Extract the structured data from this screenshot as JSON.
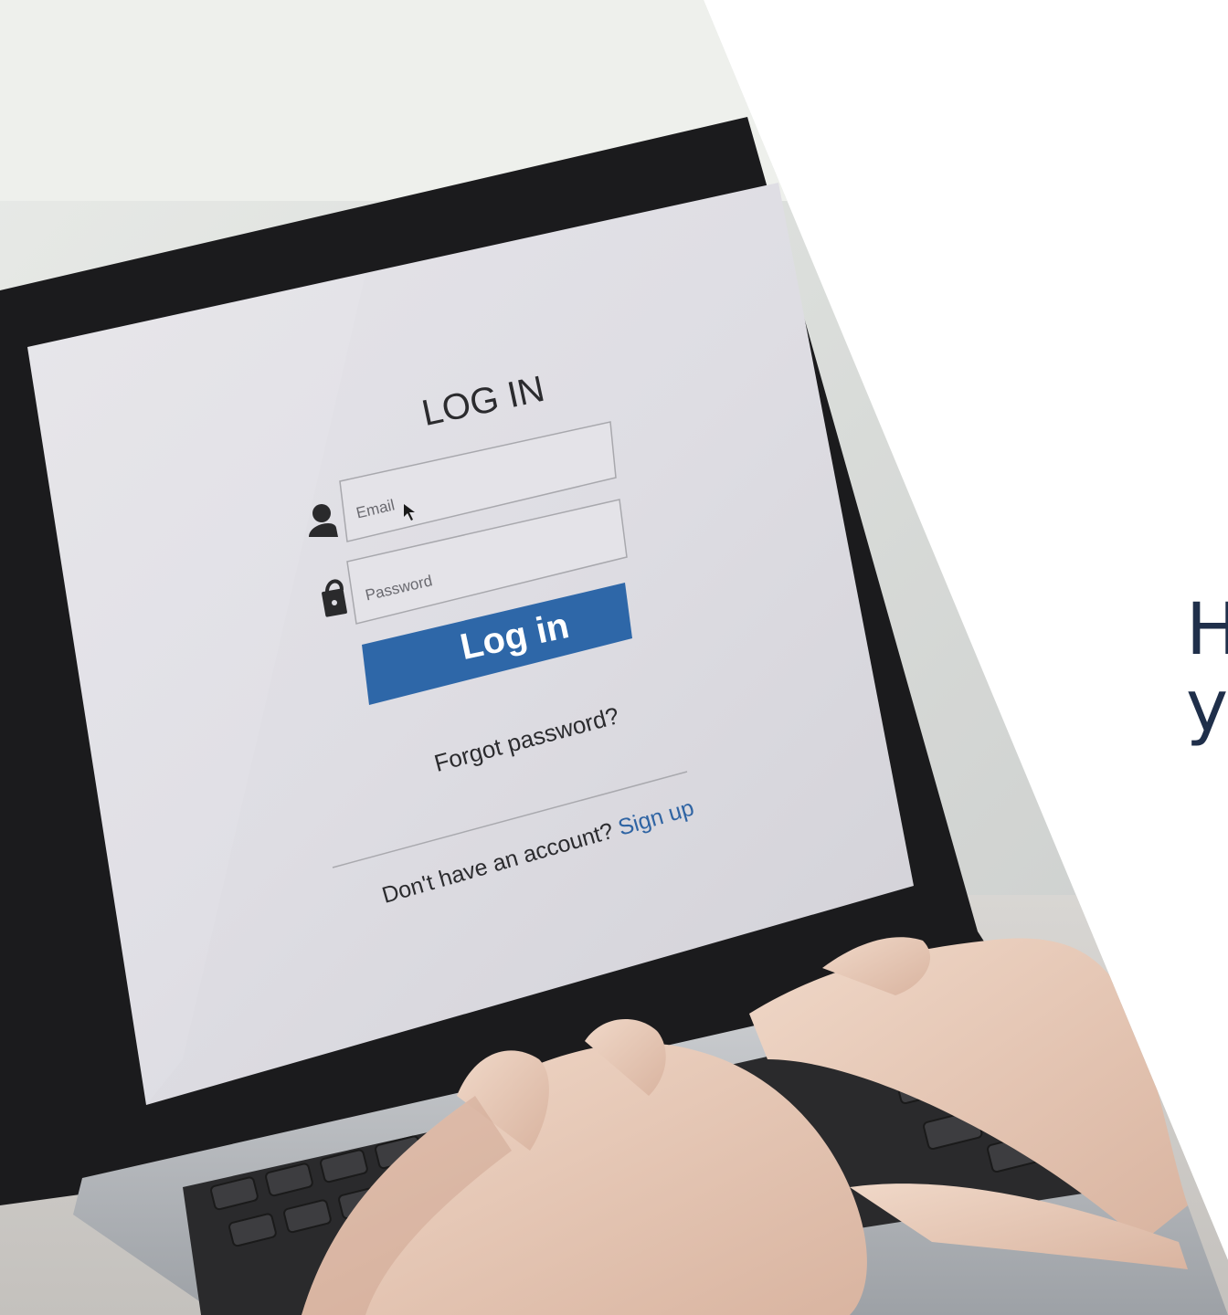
{
  "photo": {
    "description_icon": "laptop-photo",
    "screen": {
      "title": "LOG IN",
      "email_placeholder": "Email",
      "password_placeholder": "Password",
      "login_button": "Log in",
      "forgot_link": "Forgot password?",
      "signup_prompt": "Don't have an account?",
      "signup_link": "Sign up",
      "button_color": "#2e67a8",
      "link_color": "#2f64a3"
    }
  },
  "headline": {
    "line1": "H",
    "line2": "y"
  },
  "colors": {
    "headline": "#1f2f4a",
    "background": "#ffffff"
  }
}
